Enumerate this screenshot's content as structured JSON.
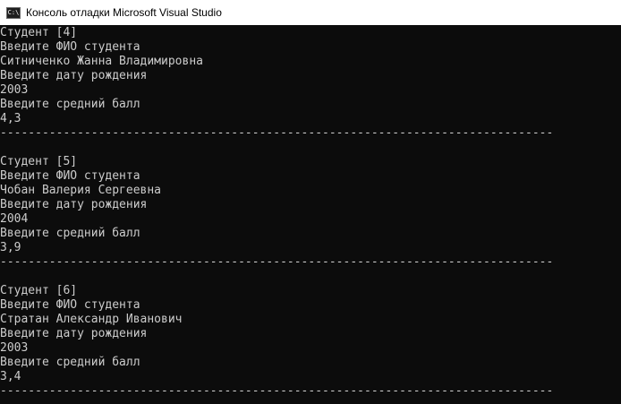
{
  "window": {
    "title": "Консоль отладки Microsoft Visual Studio",
    "icon": "console-app-icon",
    "icon_text": "C:\\"
  },
  "console": {
    "blocks": [
      {
        "header": "Студент [4]",
        "prompt_name": "Введите ФИО студента",
        "name": "Ситниченко Жанна Владимировна",
        "prompt_dob": "Введите дату рождения",
        "dob": "2003",
        "prompt_grade": "Введите средний балл",
        "grade": "4,3",
        "separator": "---------------------------------------------------------------------------------------"
      },
      {
        "header": "Студент [5]",
        "prompt_name": "Введите ФИО студента",
        "name": "Чобан Валерия Сергеевна",
        "prompt_dob": "Введите дату рождения",
        "dob": "2004",
        "prompt_grade": "Введите средний балл",
        "grade": "3,9",
        "separator": "---------------------------------------------------------------------------------------"
      },
      {
        "header": "Студент [6]",
        "prompt_name": "Введите ФИО студента",
        "name": "Стратан Александр Иванович",
        "prompt_dob": "Введите дату рождения",
        "dob": "2003",
        "prompt_grade": "Введите средний балл",
        "grade": "3,4",
        "separator": "---------------------------------------------------------------------------------------"
      }
    ]
  },
  "colors": {
    "background": "#0c0c0c",
    "text": "#cccccc",
    "titlebar": "#ffffff"
  }
}
